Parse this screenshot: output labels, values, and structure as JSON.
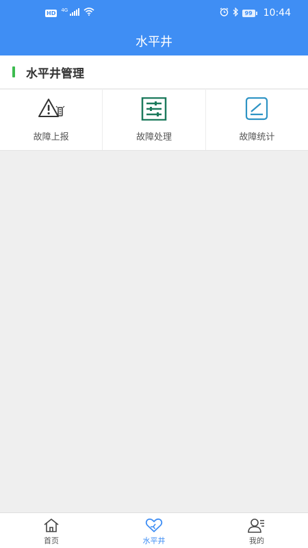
{
  "status_bar": {
    "hd": "HD",
    "network": "4G",
    "battery": "99",
    "time": "10:44"
  },
  "header": {
    "title": "水平井"
  },
  "section": {
    "title": "水平井管理",
    "accent_color": "#3dbb4f"
  },
  "grid": {
    "items": [
      {
        "label": "故障上报",
        "icon": "warning-report-icon"
      },
      {
        "label": "故障处理",
        "icon": "sliders-icon"
      },
      {
        "label": "故障统计",
        "icon": "edit-stats-icon"
      }
    ]
  },
  "bottom_nav": {
    "active_color": "#3f8ef4",
    "items": [
      {
        "label": "首页",
        "icon": "home-icon"
      },
      {
        "label": "水平井",
        "icon": "heart-icon"
      },
      {
        "label": "我的",
        "icon": "user-icon"
      }
    ]
  },
  "theme": {
    "primary": "#3f8ef4",
    "background": "#efefef"
  }
}
